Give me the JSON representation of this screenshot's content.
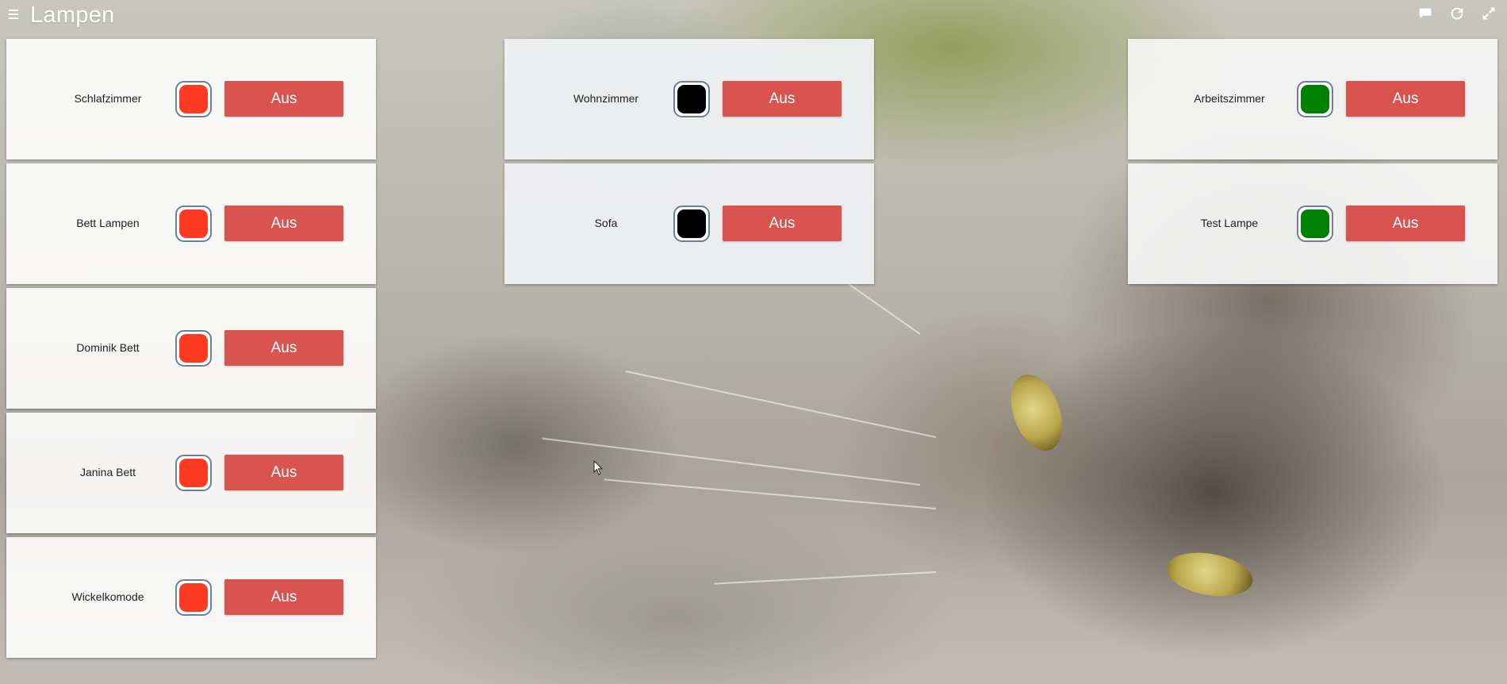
{
  "header": {
    "title": "Lampen",
    "icons": [
      "menu-icon",
      "chat-icon",
      "refresh-icon",
      "fullscreen-icon"
    ]
  },
  "button_color": "#d9534f",
  "columns": {
    "left": [
      {
        "label": "Schlafzimmer",
        "color": "#ff3a22",
        "button": "Aus"
      },
      {
        "label": "Bett Lampen",
        "color": "#ff3a22",
        "button": "Aus"
      },
      {
        "label": "Dominik Bett",
        "color": "#ff3a22",
        "button": "Aus"
      },
      {
        "label": "Janina Bett",
        "color": "#ff3a22",
        "button": "Aus"
      },
      {
        "label": "Wickelkomode",
        "color": "#ff3a22",
        "button": "Aus"
      }
    ],
    "middle": [
      {
        "label": "Wohnzimmer",
        "color": "#000000",
        "button": "Aus"
      },
      {
        "label": "Sofa",
        "color": "#000000",
        "button": "Aus"
      }
    ],
    "right": [
      {
        "label": "Arbeitszimmer",
        "color": "#008000",
        "button": "Aus"
      },
      {
        "label": "Test Lampe",
        "color": "#008000",
        "button": "Aus"
      }
    ]
  }
}
